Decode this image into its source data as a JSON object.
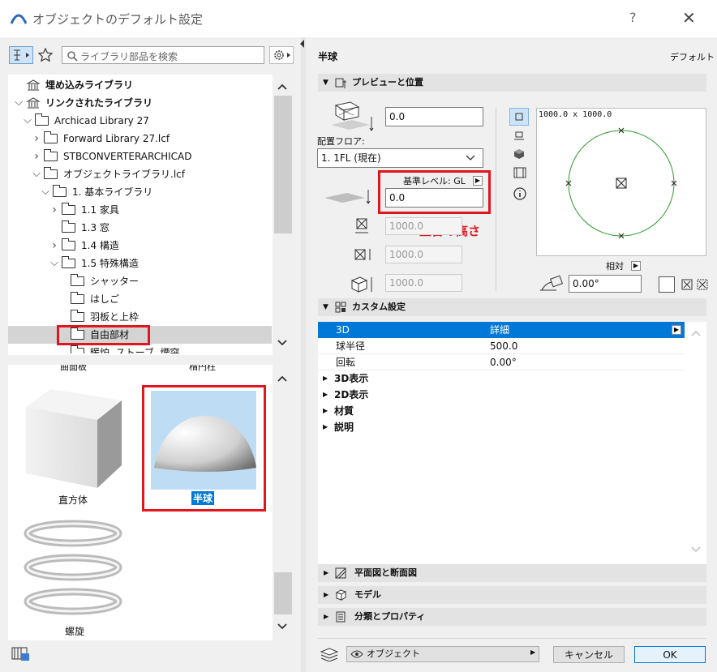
{
  "window": {
    "title": "オブジェクトのデフォルト設定",
    "help": "?",
    "close": "✕"
  },
  "left": {
    "search_placeholder": "ライブラリ部品を検索",
    "tree": [
      {
        "label": "埋め込みライブラリ",
        "bold": true
      },
      {
        "label": "リンクされたライブラリ",
        "bold": true
      },
      {
        "label": "Archicad Library 27"
      },
      {
        "label": "Forward Library 27.lcf"
      },
      {
        "label": "STBCONVERTERARCHICAD"
      },
      {
        "label": "オブジェクトライブラリ.lcf"
      },
      {
        "label": "1. 基本ライブラリ"
      },
      {
        "label": "1.1 家具"
      },
      {
        "label": "1.3 窓"
      },
      {
        "label": "1.4 構造"
      },
      {
        "label": "1.5 特殊構造"
      },
      {
        "label": "シャッター"
      },
      {
        "label": "はしご"
      },
      {
        "label": "羽板と上枠"
      },
      {
        "label": "自由部材"
      },
      {
        "label": "暖炉, ストーブ, 煙突"
      }
    ],
    "preview_cut_labels": [
      "曲面板",
      "楕円柱"
    ],
    "previews": [
      {
        "label": "直方体"
      },
      {
        "label": "半球"
      },
      {
        "label": "螺旋"
      }
    ]
  },
  "right": {
    "object_name": "半球",
    "default_label": "デフォルト",
    "sections": {
      "preview_position": "プレビューと位置",
      "custom": "カスタム設定",
      "plan_section": "平面図と断面図",
      "model": "モデル",
      "classification": "分類とプロパティ"
    },
    "height_value": "0.0",
    "floor_label": "配置フロア:",
    "floor_value": "1. 1FL (現在)",
    "ref_level_label": "基準レベル: GL",
    "ref_level_value": "0.0",
    "annotation": "土台の高さ",
    "dim1": "1000.0",
    "dim2": "1000.0",
    "dim3": "1000.0",
    "preview_size": "1000.0 x 1000.0",
    "relative_label": "相対",
    "angle_value": "0.00°",
    "params": [
      {
        "name": "3D",
        "value": "詳細",
        "selected": true
      },
      {
        "name": "球半径",
        "value": "500.0"
      },
      {
        "name": "回転",
        "value": "0.00°"
      }
    ],
    "groups": [
      "3D表示",
      "2D表示",
      "材質",
      "説明"
    ],
    "layer_value": "オブジェクト",
    "cancel_label": "キャンセル",
    "ok_label": "OK"
  },
  "colors": {
    "accent": "#0078d7",
    "red": "#e0161f",
    "circle": "#2a9a2a"
  }
}
